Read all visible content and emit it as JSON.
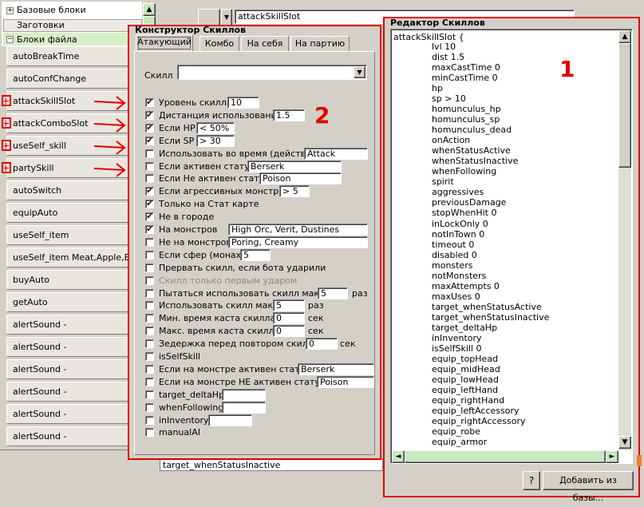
{
  "tree": {
    "base_blocks": "Базовые блоки",
    "templates": "Заготовки",
    "file_blocks": "Блоки файла"
  },
  "blocks": [
    "autoBreakTime",
    "autoConfChange",
    "attackSkillSlot",
    "attackComboSlot",
    "useSelf_skill",
    "partySkill",
    "autoSwitch",
    "equipAuto",
    "useSelf_item",
    "useSelf_item Meat,Apple,Banana",
    "buyAuto",
    "getAuto",
    "alertSound -",
    "alertSound -",
    "alertSound -",
    "alertSound -",
    "alertSound -",
    "alertSound -"
  ],
  "top_combo_value": "attackSkillSlot",
  "bottom_field": "target_whenStatusInactive",
  "constructor": {
    "title": "Конструктор Скиллов",
    "tabs": [
      "Атакующий",
      "Комбо",
      "На себя",
      "На партию"
    ],
    "skill_label": "Скилл",
    "skill_value": "",
    "annotation_number": "2",
    "rows": [
      {
        "label": "Уровень скилла",
        "checked": true,
        "value": "10"
      },
      {
        "label": "Дистанция использования",
        "checked": true,
        "value": "1.5"
      },
      {
        "label": "Если HP",
        "checked": true,
        "value": "< 50%"
      },
      {
        "label": "Если SP",
        "checked": true,
        "value": "> 30"
      },
      {
        "label": "Использовать во время (действие)",
        "checked": false,
        "value": "Attack"
      },
      {
        "label": "Если активен статус",
        "checked": false,
        "value": "Berserk"
      },
      {
        "label": "Если Не активен статус",
        "checked": false,
        "value": "Poison"
      },
      {
        "label": "Если агрессивных монстров",
        "checked": true,
        "value": "> 5"
      },
      {
        "label": "Только на Стат карте",
        "checked": true,
        "value": null
      },
      {
        "label": "Не в городе",
        "checked": true,
        "value": null
      },
      {
        "label": "На монстров",
        "checked": true,
        "value": "High Orc, Verit, Dustines"
      },
      {
        "label": "Не на монстров",
        "checked": false,
        "value": "Poring, Creamy"
      },
      {
        "label": "Если сфер (монах)",
        "checked": false,
        "value": "5"
      },
      {
        "label": "Прервать скилл, если бота ударили",
        "checked": false,
        "value": null
      },
      {
        "label": "Скилл только первым ударом",
        "checked": false,
        "value": null,
        "disabled": true
      },
      {
        "label": "Пытаться использовать скилл макс.",
        "checked": false,
        "value": "5",
        "suffix": "раз"
      },
      {
        "label": "Использовать скилл макс.",
        "checked": false,
        "value": "5",
        "suffix": "раз"
      },
      {
        "label": "Мин. время каста скилла",
        "checked": false,
        "value": "0",
        "suffix": "сек"
      },
      {
        "label": "Макс. время каста скилла",
        "checked": false,
        "value": "0",
        "suffix": "сек"
      },
      {
        "label": "Зедержка перед повтором скилла",
        "checked": false,
        "value": "0",
        "suffix": "сек"
      },
      {
        "label": "isSelfSkill",
        "checked": false,
        "value": null
      },
      {
        "label": "Если на монстре активен статус",
        "checked": false,
        "value": "Berserk"
      },
      {
        "label": "Если на монстре НЕ активен статус",
        "checked": false,
        "value": "Poison"
      },
      {
        "label": "target_deltaHp",
        "checked": false,
        "value": ""
      },
      {
        "label": "whenFollowing",
        "checked": false,
        "value": ""
      },
      {
        "label": "inInventory",
        "checked": false,
        "value": ""
      },
      {
        "label": "manualAI",
        "checked": false,
        "value": null
      }
    ]
  },
  "editor": {
    "title": "Редактор Скиллов",
    "annotation_number": "1",
    "header_line": "attackSkillSlot {",
    "lines": [
      "lvl 10",
      "dist 1.5",
      "maxCastTime 0",
      "minCastTime 0",
      "hp",
      "sp > 10",
      "homunculus_hp",
      "homunculus_sp",
      "homunculus_dead",
      "onAction",
      "whenStatusActive",
      "whenStatusInactive",
      "whenFollowing",
      "spirit",
      "aggressives",
      "previousDamage",
      "stopWhenHit 0",
      "inLockOnly 0",
      "notInTown 0",
      "timeout 0",
      "disabled 0",
      "monsters",
      "notMonsters",
      "maxAttempts 0",
      "maxUses 0",
      "target_whenStatusActive",
      "target_whenStatusInactive",
      "target_deltaHp",
      "inInventory",
      "isSelfSkill 0",
      "equip_topHead",
      "equip_midHead",
      "equip_lowHead",
      "equip_leftHand",
      "equip_rightHand",
      "equip_leftAccessory",
      "equip_rightAccessory",
      "equip_robe",
      "equip_armor"
    ],
    "help_button": "?",
    "add_button": "Добавить из базы..."
  },
  "colors": {
    "annotation_red": "#e00000",
    "tree_green": "#d8f0c8"
  }
}
